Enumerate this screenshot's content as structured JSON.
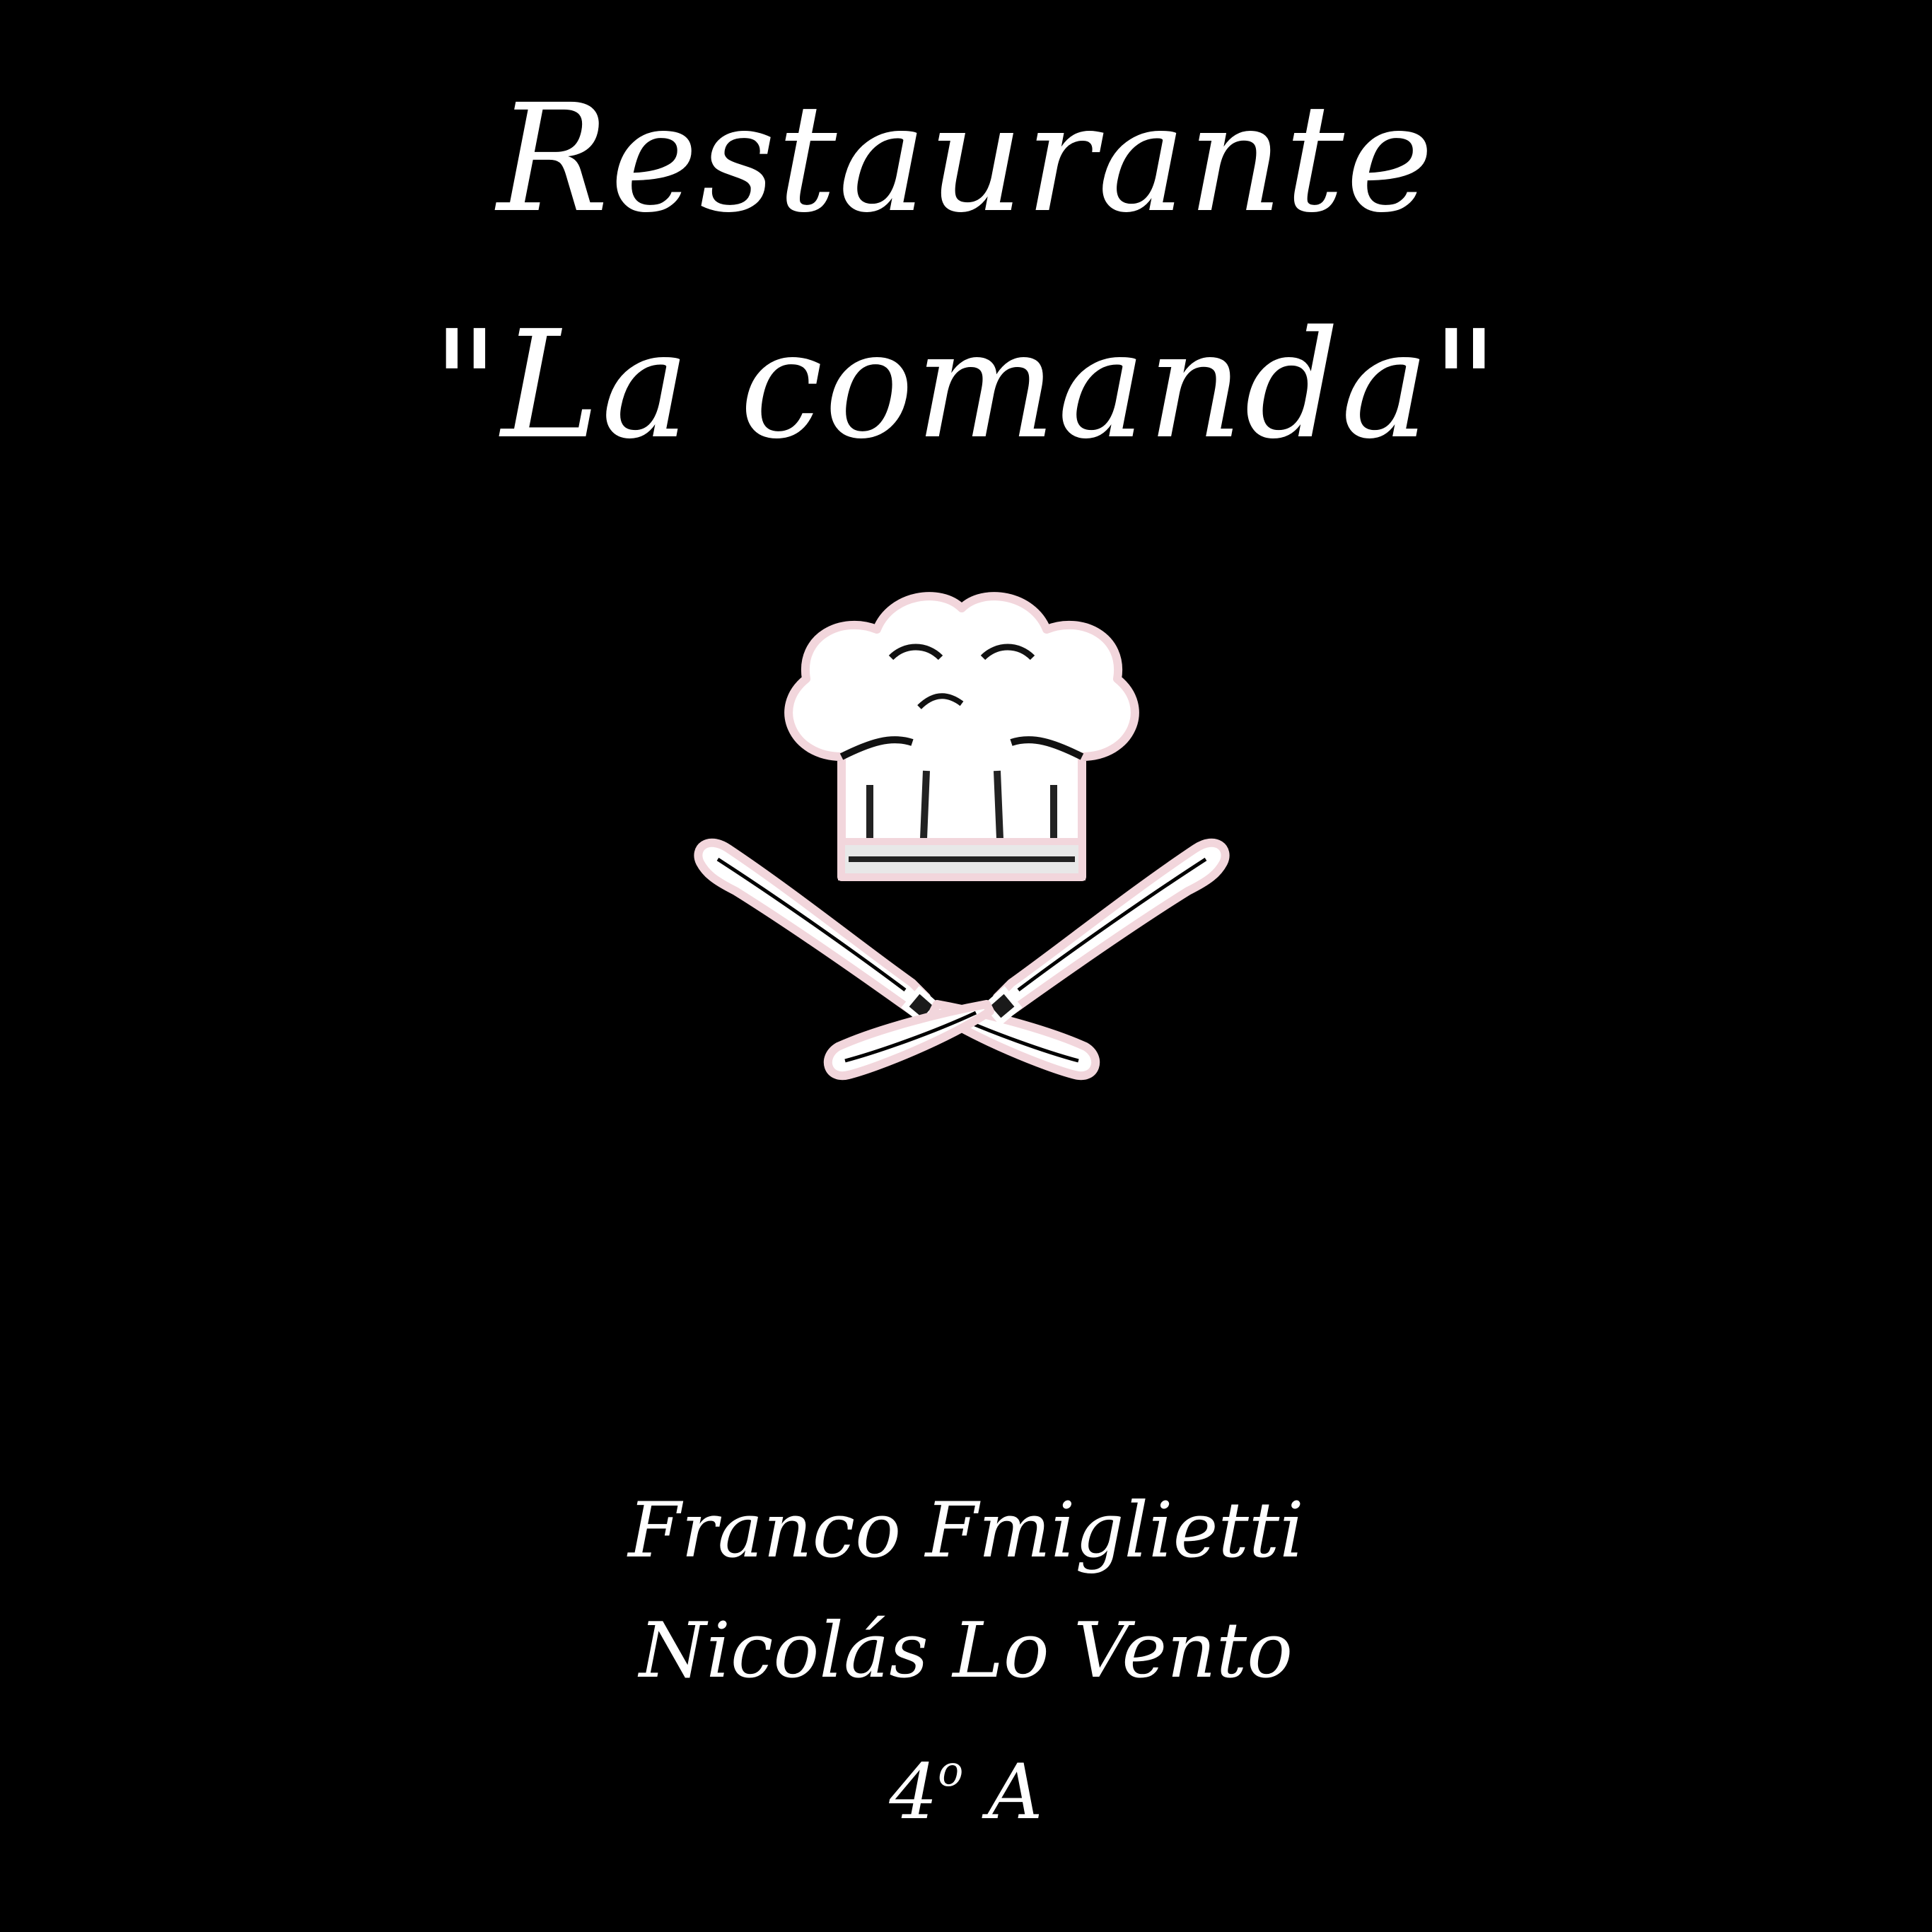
{
  "title": {
    "line1": "Restaurante",
    "line2": "\"La comanda\""
  },
  "logo": {
    "icon": "chef-hat-crossed-knives-icon"
  },
  "credits": {
    "author1": "Franco Fmiglietti",
    "author2": "Nicolás Lo Vento",
    "grade_number": "4",
    "grade_ordinal": "o",
    "grade_letter": "A"
  },
  "colors": {
    "background": "#000000",
    "text": "#ffffff",
    "outline": "#f2d6dc"
  }
}
